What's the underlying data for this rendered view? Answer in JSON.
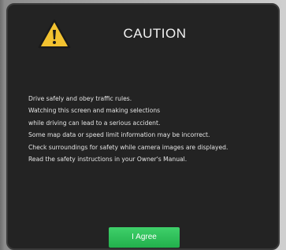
{
  "dialog": {
    "title": "CAUTION",
    "icon": "warning-triangle-icon",
    "lines": [
      "Drive safely and obey traffic rules.",
      "Watching this screen and making selections",
      "while driving can lead to a serious accident.",
      "Some map data or speed limit information may be incorrect.",
      "Check surroundings for safety while camera images are displayed.",
      "Read the safety instructions in your Owner's Manual."
    ],
    "agree_label": "I Agree"
  },
  "colors": {
    "dialog_bg": "#232323",
    "button_green": "#2dbd58",
    "icon_yellow": "#f2c230"
  }
}
